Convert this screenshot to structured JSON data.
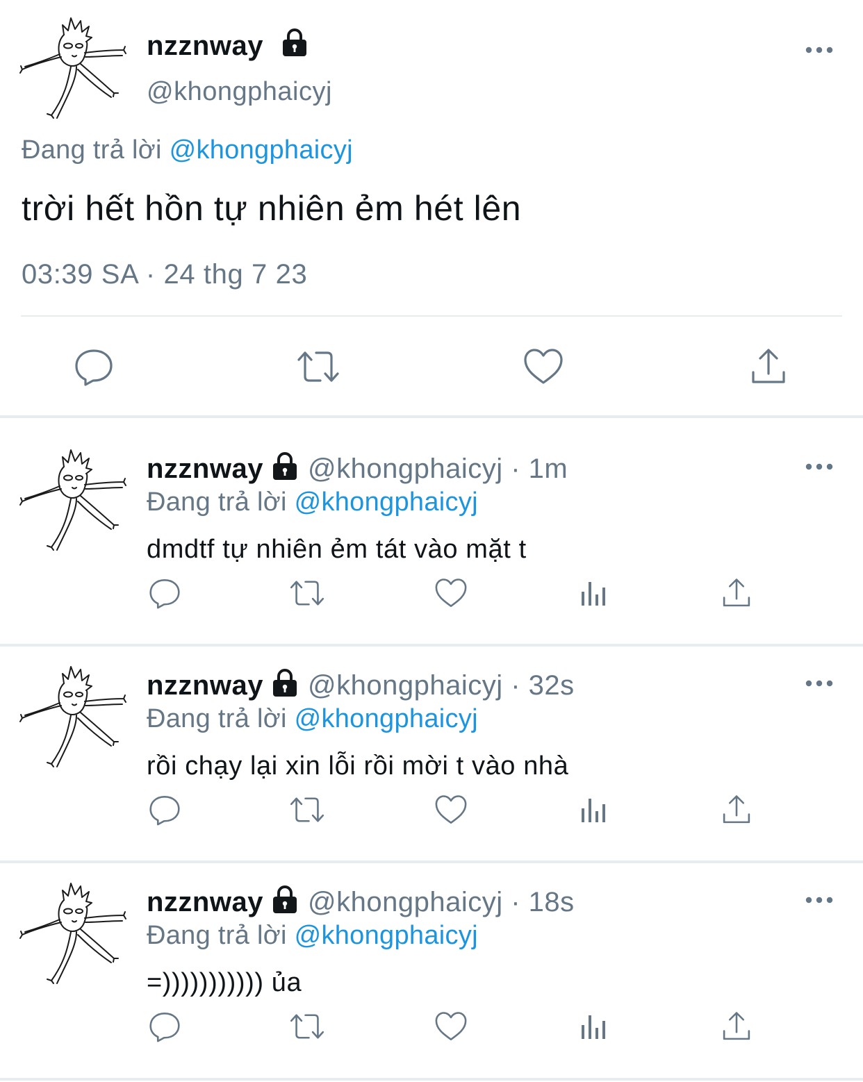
{
  "main_tweet": {
    "name": "nzznway",
    "handle": "@khongphaicyj",
    "replying_prefix": "Đang trả lời ",
    "replying_to": "@khongphaicyj",
    "text": "trời hết hồn tự nhiên ẻm hét lên",
    "timestamp": "03:39 SA · 24 thg 7 23",
    "actions": [
      "reply-icon",
      "retweet-icon",
      "like-icon",
      "share-icon"
    ]
  },
  "replies": [
    {
      "name": "nzznway",
      "handle": "@khongphaicyj · 1m",
      "replying_prefix": "Đang trả lời ",
      "replying_to": "@khongphaicyj",
      "text": "dmdtf tự nhiên ẻm tát vào mặt t"
    },
    {
      "name": "nzznway",
      "handle": "@khongphaicyj · 32s",
      "replying_prefix": "Đang trả lời ",
      "replying_to": "@khongphaicyj",
      "text": "rồi chạy lại xin lỗi rồi mời t vào nhà"
    },
    {
      "name": "nzznway",
      "handle": "@khongphaicyj · 18s",
      "replying_prefix": "Đang trả lời ",
      "replying_to": "@khongphaicyj",
      "text": "=))))))))))) ủa"
    }
  ],
  "reply_actions": [
    "reply-icon",
    "retweet-icon",
    "like-icon",
    "analytics-icon",
    "share-icon"
  ],
  "colors": {
    "link": "#1b95e0",
    "secondary": "#657786",
    "divider": "#e6ecf0",
    "text": "#0f1419"
  }
}
